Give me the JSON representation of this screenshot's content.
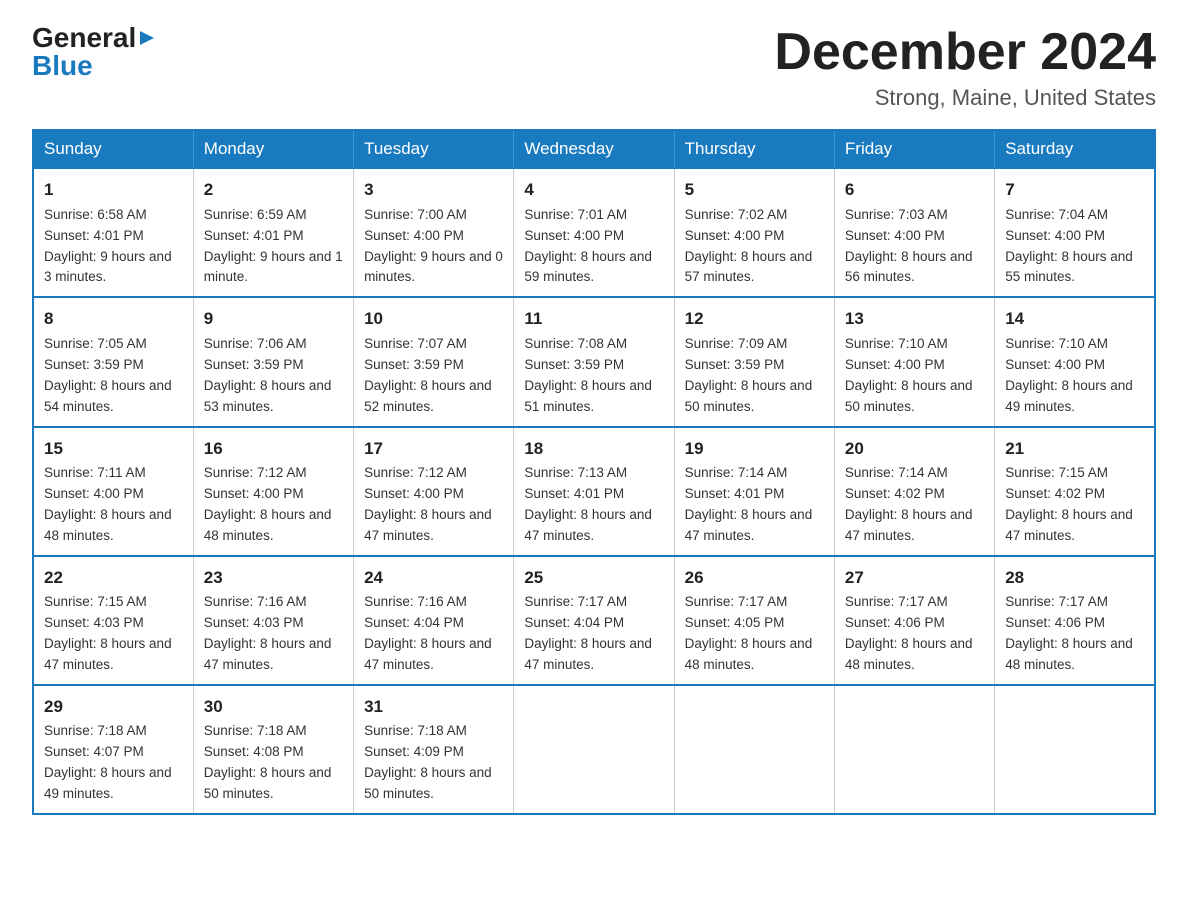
{
  "logo": {
    "general_text": "General",
    "blue_text": "Blue"
  },
  "title": {
    "month_year": "December 2024",
    "location": "Strong, Maine, United States"
  },
  "weekdays": [
    "Sunday",
    "Monday",
    "Tuesday",
    "Wednesday",
    "Thursday",
    "Friday",
    "Saturday"
  ],
  "weeks": [
    [
      {
        "day": "1",
        "sunrise": "6:58 AM",
        "sunset": "4:01 PM",
        "daylight": "9 hours and 3 minutes."
      },
      {
        "day": "2",
        "sunrise": "6:59 AM",
        "sunset": "4:01 PM",
        "daylight": "9 hours and 1 minute."
      },
      {
        "day": "3",
        "sunrise": "7:00 AM",
        "sunset": "4:00 PM",
        "daylight": "9 hours and 0 minutes."
      },
      {
        "day": "4",
        "sunrise": "7:01 AM",
        "sunset": "4:00 PM",
        "daylight": "8 hours and 59 minutes."
      },
      {
        "day": "5",
        "sunrise": "7:02 AM",
        "sunset": "4:00 PM",
        "daylight": "8 hours and 57 minutes."
      },
      {
        "day": "6",
        "sunrise": "7:03 AM",
        "sunset": "4:00 PM",
        "daylight": "8 hours and 56 minutes."
      },
      {
        "day": "7",
        "sunrise": "7:04 AM",
        "sunset": "4:00 PM",
        "daylight": "8 hours and 55 minutes."
      }
    ],
    [
      {
        "day": "8",
        "sunrise": "7:05 AM",
        "sunset": "3:59 PM",
        "daylight": "8 hours and 54 minutes."
      },
      {
        "day": "9",
        "sunrise": "7:06 AM",
        "sunset": "3:59 PM",
        "daylight": "8 hours and 53 minutes."
      },
      {
        "day": "10",
        "sunrise": "7:07 AM",
        "sunset": "3:59 PM",
        "daylight": "8 hours and 52 minutes."
      },
      {
        "day": "11",
        "sunrise": "7:08 AM",
        "sunset": "3:59 PM",
        "daylight": "8 hours and 51 minutes."
      },
      {
        "day": "12",
        "sunrise": "7:09 AM",
        "sunset": "3:59 PM",
        "daylight": "8 hours and 50 minutes."
      },
      {
        "day": "13",
        "sunrise": "7:10 AM",
        "sunset": "4:00 PM",
        "daylight": "8 hours and 50 minutes."
      },
      {
        "day": "14",
        "sunrise": "7:10 AM",
        "sunset": "4:00 PM",
        "daylight": "8 hours and 49 minutes."
      }
    ],
    [
      {
        "day": "15",
        "sunrise": "7:11 AM",
        "sunset": "4:00 PM",
        "daylight": "8 hours and 48 minutes."
      },
      {
        "day": "16",
        "sunrise": "7:12 AM",
        "sunset": "4:00 PM",
        "daylight": "8 hours and 48 minutes."
      },
      {
        "day": "17",
        "sunrise": "7:12 AM",
        "sunset": "4:00 PM",
        "daylight": "8 hours and 47 minutes."
      },
      {
        "day": "18",
        "sunrise": "7:13 AM",
        "sunset": "4:01 PM",
        "daylight": "8 hours and 47 minutes."
      },
      {
        "day": "19",
        "sunrise": "7:14 AM",
        "sunset": "4:01 PM",
        "daylight": "8 hours and 47 minutes."
      },
      {
        "day": "20",
        "sunrise": "7:14 AM",
        "sunset": "4:02 PM",
        "daylight": "8 hours and 47 minutes."
      },
      {
        "day": "21",
        "sunrise": "7:15 AM",
        "sunset": "4:02 PM",
        "daylight": "8 hours and 47 minutes."
      }
    ],
    [
      {
        "day": "22",
        "sunrise": "7:15 AM",
        "sunset": "4:03 PM",
        "daylight": "8 hours and 47 minutes."
      },
      {
        "day": "23",
        "sunrise": "7:16 AM",
        "sunset": "4:03 PM",
        "daylight": "8 hours and 47 minutes."
      },
      {
        "day": "24",
        "sunrise": "7:16 AM",
        "sunset": "4:04 PM",
        "daylight": "8 hours and 47 minutes."
      },
      {
        "day": "25",
        "sunrise": "7:17 AM",
        "sunset": "4:04 PM",
        "daylight": "8 hours and 47 minutes."
      },
      {
        "day": "26",
        "sunrise": "7:17 AM",
        "sunset": "4:05 PM",
        "daylight": "8 hours and 48 minutes."
      },
      {
        "day": "27",
        "sunrise": "7:17 AM",
        "sunset": "4:06 PM",
        "daylight": "8 hours and 48 minutes."
      },
      {
        "day": "28",
        "sunrise": "7:17 AM",
        "sunset": "4:06 PM",
        "daylight": "8 hours and 48 minutes."
      }
    ],
    [
      {
        "day": "29",
        "sunrise": "7:18 AM",
        "sunset": "4:07 PM",
        "daylight": "8 hours and 49 minutes."
      },
      {
        "day": "30",
        "sunrise": "7:18 AM",
        "sunset": "4:08 PM",
        "daylight": "8 hours and 50 minutes."
      },
      {
        "day": "31",
        "sunrise": "7:18 AM",
        "sunset": "4:09 PM",
        "daylight": "8 hours and 50 minutes."
      },
      null,
      null,
      null,
      null
    ]
  ]
}
